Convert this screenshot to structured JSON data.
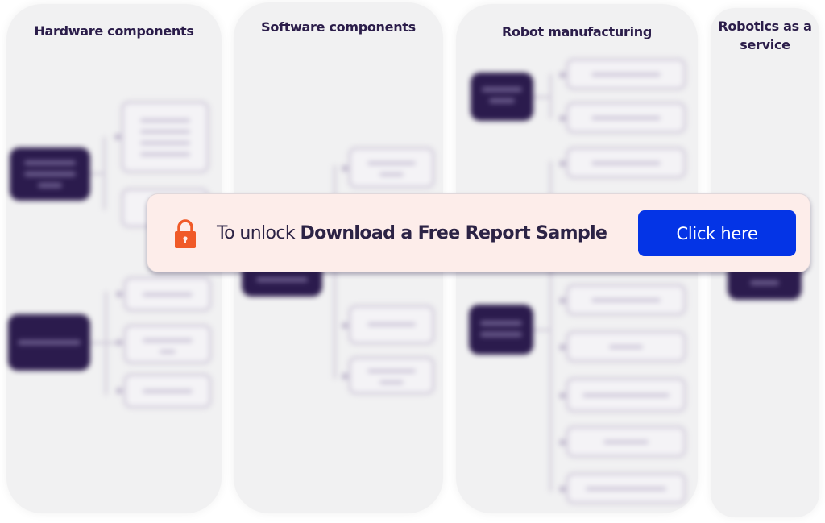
{
  "columns": [
    {
      "title": "Hardware components"
    },
    {
      "title": "Software components"
    },
    {
      "title": "Robot manufacturing"
    },
    {
      "title_line1": "Robotics as a",
      "title_line2": "service"
    }
  ],
  "overlay": {
    "prefix": "To unlock ",
    "highlight": "Download a Free Report Sample",
    "button_label": "Click here",
    "lock_icon": "lock-icon",
    "colors": {
      "banner_bg": "#fdedea",
      "button_bg": "#0434e6",
      "lock": "#f05a28",
      "text": "#2c2345"
    }
  },
  "diagram_colors": {
    "category_node": "#2b1b4d",
    "leaf_node_border": "#d6d1de",
    "panel_bg": "#f1f1f2"
  }
}
